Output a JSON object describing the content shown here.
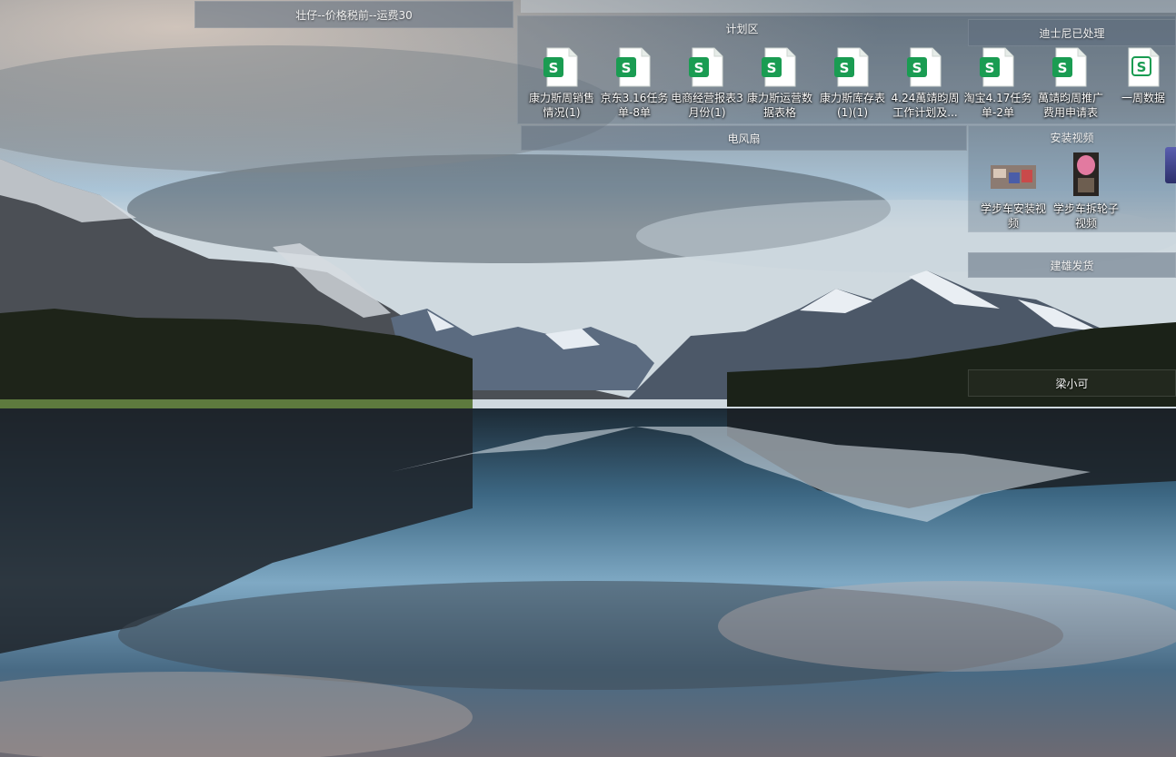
{
  "fences": {
    "zhuangzai": {
      "title": "壮仔--价格税前--运费30"
    },
    "plan": {
      "title": "计划区",
      "items": [
        {
          "label": "康力斯周销售情况(1)",
          "icon": "sheet-icon"
        },
        {
          "label": "京东3.16任务单-8单",
          "icon": "sheet-icon"
        },
        {
          "label": "电商经营报表3月份(1)",
          "icon": "sheet-icon"
        },
        {
          "label": "康力斯运营数据表格",
          "icon": "sheet-icon"
        },
        {
          "label": "康力斯库存表(1)(1)",
          "icon": "sheet-icon"
        },
        {
          "label": "4.24萬靖昀周工作计划及...",
          "icon": "sheet-icon"
        },
        {
          "label": "淘宝4.17任务单-2单",
          "icon": "sheet-icon"
        },
        {
          "label": "萬靖昀周推广费用申请表",
          "icon": "sheet-icon"
        },
        {
          "label": "一周数据",
          "icon": "sheet-icon-outline"
        }
      ]
    },
    "disney": {
      "title": "迪士尼已处理"
    },
    "fan": {
      "title": "电风扇"
    },
    "install_video": {
      "title": "安装视频",
      "items": [
        {
          "label": "学步车安装视频",
          "icon": "video-thumbnail"
        },
        {
          "label": "学步车拆轮子视频",
          "icon": "video-thumbnail"
        }
      ]
    },
    "jianxiong": {
      "title": "建雄发货"
    },
    "liangxiaoke": {
      "title": "梁小可"
    }
  },
  "colors": {
    "sheet_green": "#1a9c52",
    "panel_tint": "#5f6e7d"
  }
}
